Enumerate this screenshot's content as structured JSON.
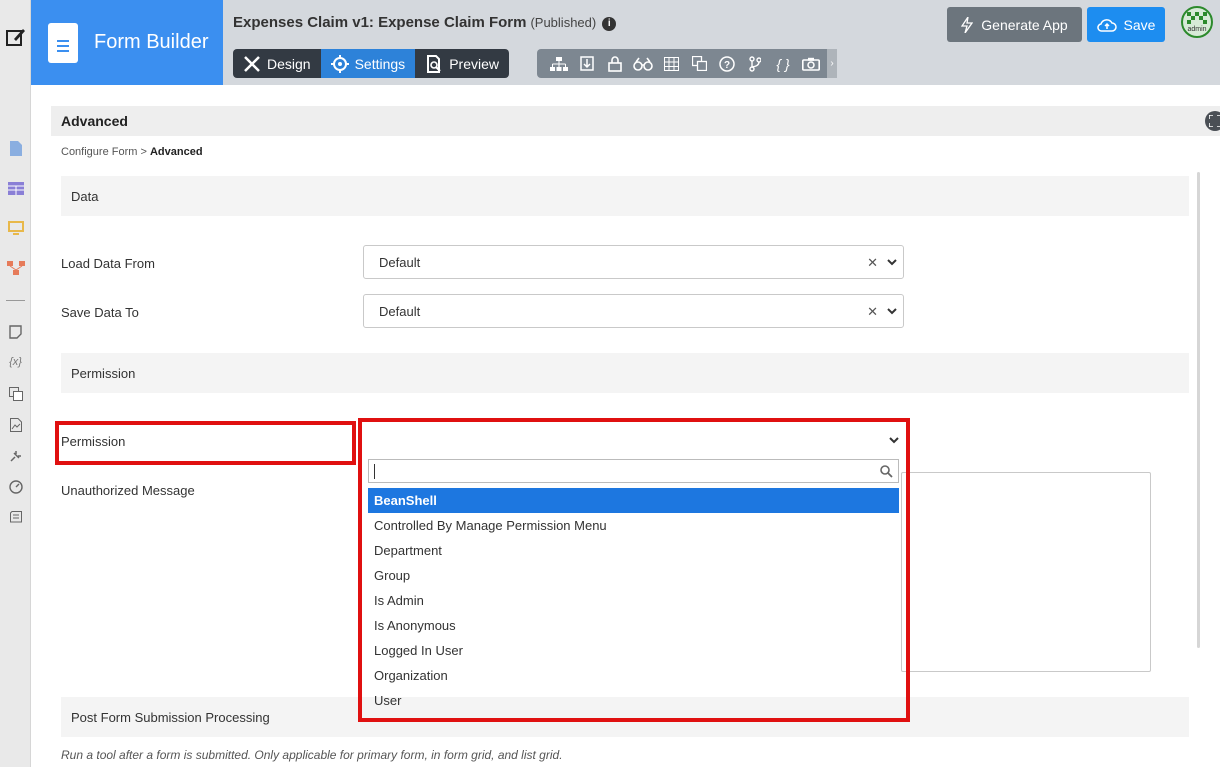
{
  "header": {
    "app_title": "Form Builder",
    "form_title": "Expenses Claim v1: Expense Claim Form",
    "form_status": "(Published)",
    "tabs": [
      {
        "label": "Design"
      },
      {
        "label": "Settings"
      },
      {
        "label": "Preview"
      }
    ],
    "generate_label": "Generate App",
    "save_label": "Save",
    "avatar_text": "admin"
  },
  "panel": {
    "title": "Advanced",
    "breadcrumb_parent": "Configure Form",
    "breadcrumb_sep": ">",
    "breadcrumb_current": "Advanced"
  },
  "sections": {
    "data": "Data",
    "permission": "Permission",
    "post": "Post Form Submission Processing"
  },
  "fields": {
    "load_data_label": "Load Data From",
    "load_data_value": "Default",
    "save_data_label": "Save Data To",
    "save_data_value": "Default",
    "permission_label": "Permission",
    "unauth_label": "Unauthorized Message"
  },
  "dropdown": {
    "search_value": "",
    "options": [
      "BeanShell",
      "Controlled By Manage Permission Menu",
      "Department",
      "Group",
      "Is Admin",
      "Is Anonymous",
      "Logged In User",
      "Organization",
      "User"
    ],
    "highlighted": "BeanShell"
  },
  "hint": "Run a tool after a form is submitted. Only applicable for primary form, in form grid, and list grid.",
  "colors": {
    "brand": "#3b8ff0",
    "active_tab": "#2d82d9",
    "highlight": "#e01010",
    "selected_option": "#1d77e0"
  }
}
